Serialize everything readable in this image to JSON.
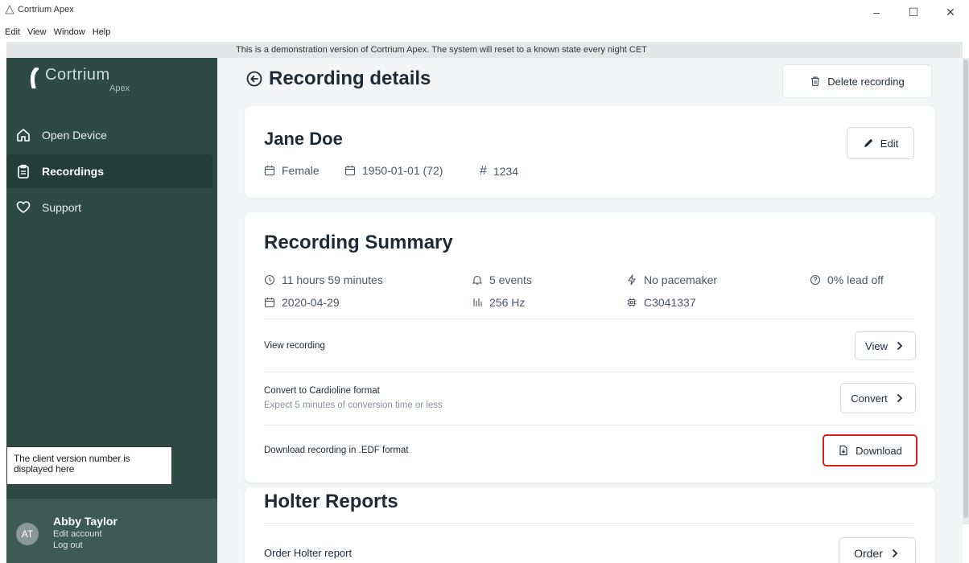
{
  "window": {
    "title": "Cortrium Apex",
    "minimize": "–",
    "maximize": "☐",
    "close": "✕"
  },
  "menu": [
    "Edit",
    "View",
    "Window",
    "Help"
  ],
  "banner": "This is a demonstration version of Cortrium Apex. The system will reset to a known state every night CET",
  "sidebar": {
    "logo_word": "Cortrium",
    "logo_sub": "Apex",
    "items": [
      {
        "label": "Open Device",
        "icon": "home-icon"
      },
      {
        "label": "Recordings",
        "icon": "clipboard-icon",
        "active": true
      },
      {
        "label": "Support",
        "icon": "heart-icon"
      }
    ],
    "callout": "The client version number is displayed here",
    "user": {
      "initials": "AT",
      "name": "Abby Taylor",
      "edit": "Edit account",
      "logout": "Log out"
    }
  },
  "page": {
    "title": "Recording details",
    "delete_label": "Delete recording"
  },
  "patient": {
    "name": "Jane Doe",
    "edit_label": "Edit",
    "gender": "Female",
    "dob": "1950-01-01 (72)",
    "id_symbol": "#",
    "id": "1234"
  },
  "summary": {
    "title": "Recording Summary",
    "duration": "11 hours 59 minutes",
    "events": "5 events",
    "pacemaker": "No pacemaker",
    "leadoff": "0% lead off",
    "date": "2020-04-29",
    "rate": "256 Hz",
    "device": "C3041337",
    "view_label": "View recording",
    "view_btn": "View",
    "convert_label": "Convert to Cardioline format",
    "convert_sub": "Expect 5 minutes of conversion time or less",
    "convert_btn": "Convert",
    "download_label": "Download recording in .EDF format",
    "download_btn": "Download"
  },
  "holter": {
    "title": "Holter Reports",
    "order_label": "Order Holter report",
    "order_btn": "Order"
  },
  "colors": {
    "sidebar": "#2e4a45",
    "highlight": "#d61f1f"
  }
}
